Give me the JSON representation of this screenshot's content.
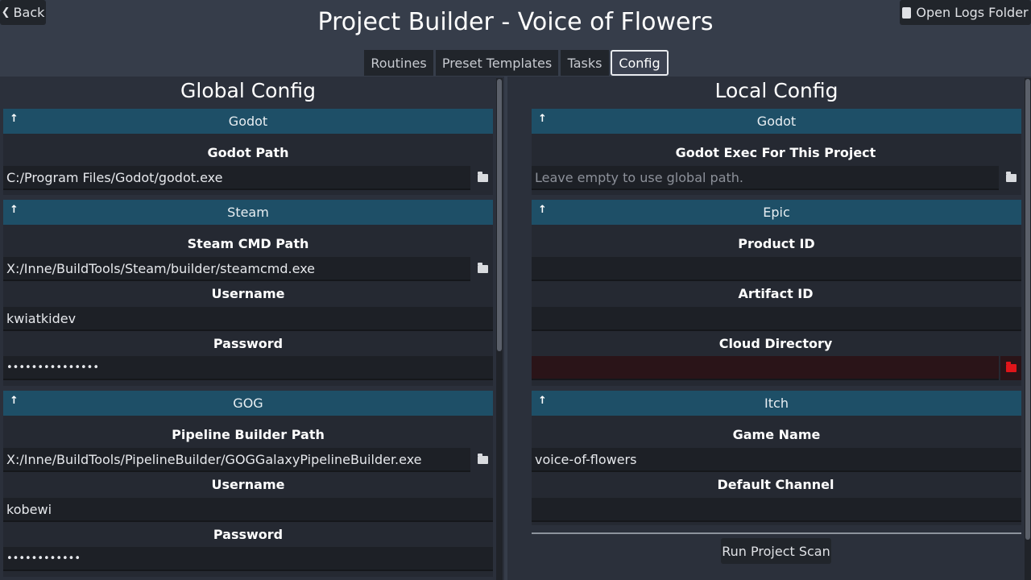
{
  "header": {
    "back_label": "Back",
    "title": "Project Builder - Voice of Flowers",
    "logs_label": "Open Logs Folder"
  },
  "tabs": [
    {
      "label": "Routines",
      "active": false
    },
    {
      "label": "Preset Templates",
      "active": false
    },
    {
      "label": "Tasks",
      "active": false
    },
    {
      "label": "Config",
      "active": true
    }
  ],
  "global": {
    "title": "Global Config",
    "godot": {
      "header": "Godot",
      "path_label": "Godot Path",
      "path_value": "C:/Program Files/Godot/godot.exe"
    },
    "steam": {
      "header": "Steam",
      "cmd_label": "Steam CMD Path",
      "cmd_value": "X:/Inne/BuildTools/Steam/builder/steamcmd.exe",
      "username_label": "Username",
      "username_value": "kwiatkidev",
      "password_label": "Password",
      "password_value": "•••••••••••••••"
    },
    "gog": {
      "header": "GOG",
      "pipeline_label": "Pipeline Builder Path",
      "pipeline_value": "X:/Inne/BuildTools/PipelineBuilder/GOGGalaxyPipelineBuilder.exe",
      "username_label": "Username",
      "username_value": "kobewi",
      "password_label": "Password",
      "password_value": "••••••••••••"
    }
  },
  "local": {
    "title": "Local Config",
    "godot": {
      "header": "Godot",
      "exec_label": "Godot Exec For This Project",
      "exec_placeholder": "Leave empty to use global path."
    },
    "epic": {
      "header": "Epic",
      "product_label": "Product ID",
      "product_value": "",
      "artifact_label": "Artifact ID",
      "artifact_value": "",
      "cloud_label": "Cloud Directory",
      "cloud_value": ""
    },
    "itch": {
      "header": "Itch",
      "game_label": "Game Name",
      "game_value": "voice-of-flowers",
      "channel_label": "Default Channel",
      "channel_value": ""
    },
    "scan_label": "Run Project Scan"
  },
  "colors": {
    "background": "#363d4a",
    "section_header": "#1e4f67",
    "error_folder": "#e0151a"
  },
  "icons": {
    "back": "chevron-left-icon",
    "logs": "scroll-icon",
    "collapse": "arrow-up-icon",
    "folder": "folder-icon"
  }
}
